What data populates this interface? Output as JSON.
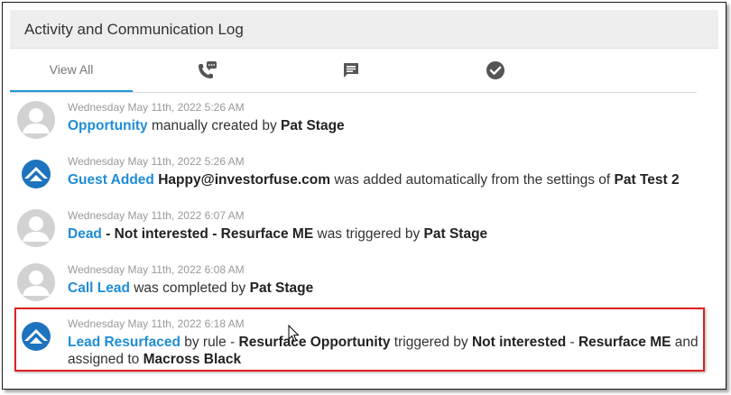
{
  "panel": {
    "title": "Activity and Communication Log"
  },
  "tabs": [
    {
      "label": "View All",
      "icon": "",
      "active": true
    },
    {
      "label": "",
      "icon": "phone-chat-icon",
      "active": false
    },
    {
      "label": "",
      "icon": "message-icon",
      "active": false
    },
    {
      "label": "",
      "icon": "check-circle-icon",
      "active": false
    }
  ],
  "colors": {
    "link": "#1f8dd6",
    "accent_underline": "#2196d3",
    "highlight_border": "#e02020",
    "brand_blue": "#1e73be"
  },
  "entries": [
    {
      "avatar": "default-user-avatar",
      "timestamp": "Wednesday May 11th, 2022 5:26 AM",
      "parts": [
        {
          "t": "Opportunity",
          "s": "link"
        },
        {
          "t": " manually created by ",
          "s": "normal"
        },
        {
          "t": "Pat Stage",
          "s": "bold"
        }
      ]
    },
    {
      "avatar": "investorfuse-logo-avatar",
      "timestamp": "Wednesday May 11th, 2022 5:26 AM",
      "parts": [
        {
          "t": "Guest Added",
          "s": "link"
        },
        {
          "t": " ",
          "s": "normal"
        },
        {
          "t": "Happy@investorfuse.com",
          "s": "bold"
        },
        {
          "t": " was added automatically from the settings of ",
          "s": "normal"
        },
        {
          "t": "Pat Test 2",
          "s": "bold"
        }
      ]
    },
    {
      "avatar": "default-user-avatar",
      "timestamp": "Wednesday May 11th, 2022 6:07 AM",
      "parts": [
        {
          "t": "Dead",
          "s": "link"
        },
        {
          "t": " - Not interested - Resurface ME",
          "s": "bold"
        },
        {
          "t": " was triggered by ",
          "s": "normal"
        },
        {
          "t": "Pat Stage",
          "s": "bold"
        }
      ]
    },
    {
      "avatar": "default-user-avatar",
      "timestamp": "Wednesday May 11th, 2022 6:08 AM",
      "parts": [
        {
          "t": "Call Lead",
          "s": "link"
        },
        {
          "t": " was completed by ",
          "s": "normal"
        },
        {
          "t": "Pat Stage",
          "s": "bold"
        }
      ]
    },
    {
      "avatar": "investorfuse-logo-avatar",
      "timestamp": "Wednesday May 11th, 2022 6:18 AM",
      "parts": [
        {
          "t": "Lead Resurfaced",
          "s": "link"
        },
        {
          "t": " by rule - ",
          "s": "normal"
        },
        {
          "t": "Resurface Opportunity",
          "s": "bold"
        },
        {
          "t": " triggered by ",
          "s": "normal"
        },
        {
          "t": "Not interested",
          "s": "bold"
        },
        {
          "t": " - ",
          "s": "normal"
        },
        {
          "t": "Resurface ME",
          "s": "bold"
        },
        {
          "t": " and assigned to ",
          "s": "normal"
        },
        {
          "t": "Macross Black",
          "s": "bold"
        }
      ]
    }
  ]
}
